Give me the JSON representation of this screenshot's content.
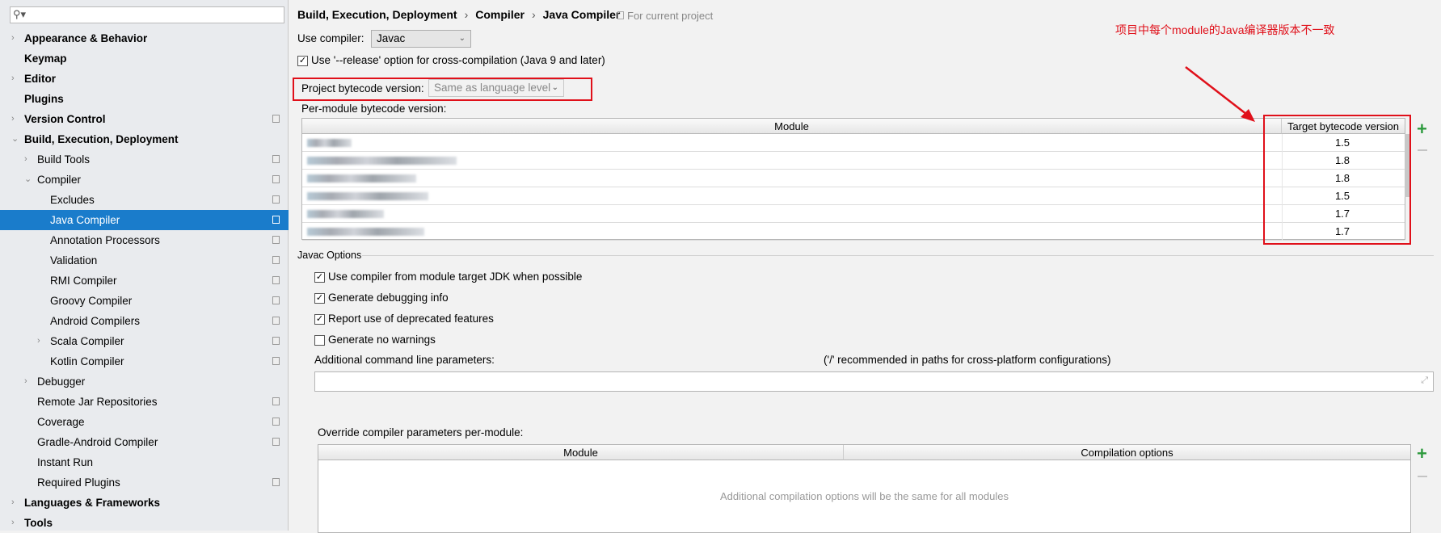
{
  "sidebar": {
    "search_placeholder": "",
    "items": [
      {
        "label": "Appearance & Behavior",
        "level": 0,
        "bold": true,
        "arrow": "right",
        "project_icon": false
      },
      {
        "label": "Keymap",
        "level": 0,
        "bold": true,
        "arrow": "",
        "project_icon": false
      },
      {
        "label": "Editor",
        "level": 0,
        "bold": true,
        "arrow": "right",
        "project_icon": false
      },
      {
        "label": "Plugins",
        "level": 0,
        "bold": true,
        "arrow": "",
        "project_icon": false
      },
      {
        "label": "Version Control",
        "level": 0,
        "bold": true,
        "arrow": "right",
        "project_icon": true
      },
      {
        "label": "Build, Execution, Deployment",
        "level": 0,
        "bold": true,
        "arrow": "down",
        "project_icon": false
      },
      {
        "label": "Build Tools",
        "level": 1,
        "bold": false,
        "arrow": "right",
        "project_icon": true
      },
      {
        "label": "Compiler",
        "level": 1,
        "bold": false,
        "arrow": "down",
        "project_icon": true
      },
      {
        "label": "Excludes",
        "level": 2,
        "bold": false,
        "arrow": "",
        "project_icon": true
      },
      {
        "label": "Java Compiler",
        "level": 2,
        "bold": false,
        "arrow": "",
        "project_icon": true,
        "selected": true
      },
      {
        "label": "Annotation Processors",
        "level": 2,
        "bold": false,
        "arrow": "",
        "project_icon": true
      },
      {
        "label": "Validation",
        "level": 2,
        "bold": false,
        "arrow": "",
        "project_icon": true
      },
      {
        "label": "RMI Compiler",
        "level": 2,
        "bold": false,
        "arrow": "",
        "project_icon": true
      },
      {
        "label": "Groovy Compiler",
        "level": 2,
        "bold": false,
        "arrow": "",
        "project_icon": true
      },
      {
        "label": "Android Compilers",
        "level": 2,
        "bold": false,
        "arrow": "",
        "project_icon": true
      },
      {
        "label": "Scala Compiler",
        "level": 2,
        "bold": false,
        "arrow": "right",
        "project_icon": true
      },
      {
        "label": "Kotlin Compiler",
        "level": 2,
        "bold": false,
        "arrow": "",
        "project_icon": true
      },
      {
        "label": "Debugger",
        "level": 1,
        "bold": false,
        "arrow": "right",
        "project_icon": false
      },
      {
        "label": "Remote Jar Repositories",
        "level": 1,
        "bold": false,
        "arrow": "",
        "project_icon": true
      },
      {
        "label": "Coverage",
        "level": 1,
        "bold": false,
        "arrow": "",
        "project_icon": true
      },
      {
        "label": "Gradle-Android Compiler",
        "level": 1,
        "bold": false,
        "arrow": "",
        "project_icon": true
      },
      {
        "label": "Instant Run",
        "level": 1,
        "bold": false,
        "arrow": "",
        "project_icon": false
      },
      {
        "label": "Required Plugins",
        "level": 1,
        "bold": false,
        "arrow": "",
        "project_icon": true
      },
      {
        "label": "Languages & Frameworks",
        "level": 0,
        "bold": true,
        "arrow": "right",
        "project_icon": false
      },
      {
        "label": "Tools",
        "level": 0,
        "bold": true,
        "arrow": "right",
        "project_icon": false
      }
    ]
  },
  "breadcrumb": [
    "Build, Execution, Deployment",
    "Compiler",
    "Java Compiler"
  ],
  "for_current_project": "For current project",
  "use_compiler": {
    "label": "Use compiler:",
    "value": "Javac"
  },
  "release_option": {
    "label": "Use '--release' option for cross-compilation (Java 9 and later)",
    "checked": true
  },
  "project_bytecode": {
    "label": "Project bytecode version:",
    "value": "Same as language level"
  },
  "per_module": {
    "label": "Per-module bytecode version:",
    "columns": [
      "Module",
      "Target bytecode version"
    ],
    "rows": [
      {
        "version": "1.5"
      },
      {
        "version": "1.8"
      },
      {
        "version": "1.8"
      },
      {
        "version": "1.5"
      },
      {
        "version": "1.7"
      },
      {
        "version": "1.7"
      }
    ]
  },
  "javac_options": {
    "title": "Javac Options",
    "checkboxes": [
      {
        "label": "Use compiler from module target JDK when possible",
        "checked": true
      },
      {
        "label": "Generate debugging info",
        "checked": true
      },
      {
        "label": "Report use of deprecated features",
        "checked": true
      },
      {
        "label": "Generate no warnings",
        "checked": false
      }
    ],
    "additional_label": "Additional command line parameters:",
    "additional_hint": "('/' recommended in paths for cross-platform configurations)",
    "additional_value": ""
  },
  "override": {
    "label": "Override compiler parameters per-module:",
    "columns": [
      "Module",
      "Compilation options"
    ],
    "empty_text": "Additional compilation options will be the same for all modules"
  },
  "annotation": {
    "text": "项目中每个module的Java编译器版本不一致",
    "color": "#e0101a"
  },
  "colors": {
    "selection": "#1a7ccb",
    "add": "#2e9a3e"
  }
}
